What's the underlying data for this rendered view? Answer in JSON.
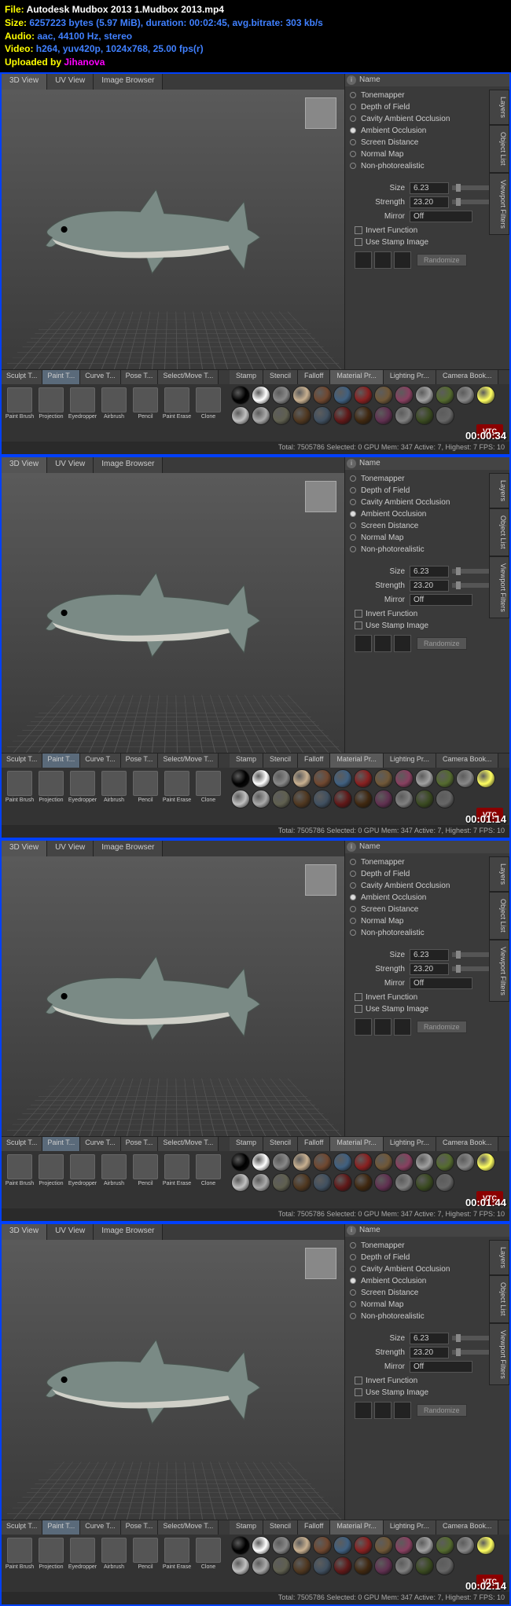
{
  "header": {
    "file_label": "File:",
    "file_value": "Autodesk Mudbox 2013 1.Mudbox 2013.mp4",
    "size_label": "Size:",
    "size_value": "6257223 bytes (5.97 MiB), duration: 00:02:45, avg.bitrate: 303 kb/s",
    "audio_label": "Audio:",
    "audio_value": "aac, 44100 Hz, stereo",
    "video_label": "Video:",
    "video_value": "h264, yuv420p, 1024x768, 25.00 fps(r)",
    "uploaded_label": "Uploaded by",
    "uploaded_value": "Jihanova"
  },
  "frames": [
    {
      "timestamp": "00:00:34"
    },
    {
      "timestamp": "00:01:14"
    },
    {
      "timestamp": "00:01:44"
    },
    {
      "timestamp": "00:02:14"
    }
  ],
  "view_tabs": [
    "3D View",
    "UV View",
    "Image Browser"
  ],
  "side_tabs": [
    "Layers",
    "Object List",
    "Viewport Filters"
  ],
  "filters_header": "Name",
  "filters": [
    {
      "name": "Tonemapper",
      "on": false
    },
    {
      "name": "Depth of Field",
      "on": false
    },
    {
      "name": "Cavity Ambient Occlusion",
      "on": false
    },
    {
      "name": "Ambient Occlusion",
      "on": true
    },
    {
      "name": "Screen Distance",
      "on": false
    },
    {
      "name": "Normal Map",
      "on": false
    },
    {
      "name": "Non-photorealistic",
      "on": false
    }
  ],
  "props": {
    "size_label": "Size",
    "size_value": "6.23",
    "strength_label": "Strength",
    "strength_value": "23.20",
    "mirror_label": "Mirror",
    "mirror_value": "Off",
    "invert_label": "Invert Function",
    "stamp_label": "Use Stamp Image",
    "randomize": "Randomize"
  },
  "tool_tabs": [
    "Sculpt T...",
    "Paint T...",
    "Curve T...",
    "Pose T...",
    "Select/Move T..."
  ],
  "tool_tabs_active": 1,
  "tools": [
    "Paint Brush",
    "Projection",
    "Eyedropper",
    "Airbrush",
    "Pencil",
    "Paint Erase",
    "Clone"
  ],
  "swatch_tabs": [
    "Stamp",
    "Stencil",
    "Falloff",
    "Material Pr...",
    "Lighting Pr...",
    "Camera Book..."
  ],
  "swatch_tabs_active": 3,
  "swatches": [
    "#000",
    "#fff",
    "#888",
    "#c8b090",
    "#704830",
    "#406080",
    "#882020",
    "#705838",
    "#884060",
    "#a0a0a0",
    "#556b2f",
    "#888",
    "#ffff60",
    "#c0c0c0",
    "#aaa",
    "#606050",
    "#503820",
    "#405060",
    "#601818",
    "#402810",
    "#603050",
    "#808080",
    "#3a4a20",
    "#666"
  ],
  "status": "Total: 7505786  Selected: 0  GPU Mem: 347    Active: 7, Highest: 7  FPS: 10",
  "vtc": "VTC"
}
